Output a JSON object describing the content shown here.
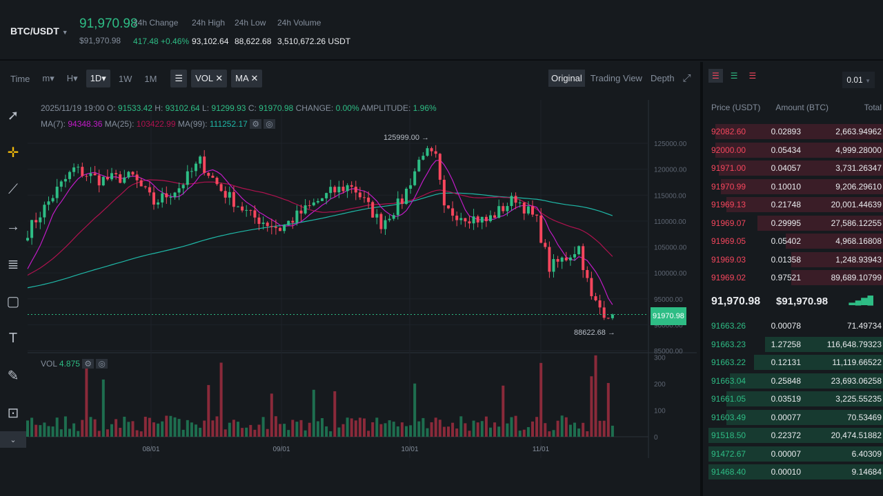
{
  "header": {
    "pair": "BTC/USDT",
    "last_price": "91,970.98",
    "last_price_usd": "$91,970.98",
    "stats": [
      {
        "label": "24h Change",
        "value": "417.48 +0.46%"
      },
      {
        "label": "24h High",
        "value": "93,102.64"
      },
      {
        "label": "24h Low",
        "value": "88,622.68"
      },
      {
        "label": "24h Volume",
        "value": "3,510,672.26 USDT"
      }
    ]
  },
  "toolbar": {
    "intervals": [
      "Time",
      "m▾",
      "H▾",
      "1D▾",
      "1W",
      "1M"
    ],
    "active": "1D▾",
    "indicators": [
      "VOL ✕",
      "MA ✕"
    ],
    "views": [
      "Original",
      "Trading View",
      "Depth"
    ]
  },
  "chart_info": {
    "date": "2025/11/19 19:00",
    "o_label": "O:",
    "o": "91533.42",
    "h_label": "H:",
    "h": "93102.64",
    "l_label": "L:",
    "l": "91299.93",
    "c_label": "C:",
    "c": "91970.98",
    "change_label": "CHANGE:",
    "change": "0.00%",
    "amp_label": "AMPLITUDE:",
    "amp": "1.96%",
    "ma7_label": "MA(7):",
    "ma7": "94348.36",
    "ma25_label": "MA(25):",
    "ma25": "103422.99",
    "ma99_label": "MA(99):",
    "ma99": "111252.17",
    "vol_label": "VOL",
    "vol": "4.875",
    "high_marker": "125999.00 →",
    "low_marker": "88622.68 →",
    "price_tag": "91970.98"
  },
  "chart_data": {
    "type": "candlestick",
    "y_ticks": [
      "125000.00",
      "120000.00",
      "115000.00",
      "110000.00",
      "105000.00",
      "100000.00",
      "95000.00",
      "90000.00",
      "85000.00"
    ],
    "vol_ticks": [
      "300",
      "200",
      "100",
      "0"
    ],
    "x_ticks": [
      "08/01",
      "09/01",
      "10/01",
      "11/01"
    ],
    "colors": {
      "up": "#2ebd85",
      "down": "#f6465d",
      "ma7": "#c21bc8",
      "ma25": "#b0124f",
      "ma99": "#1fb9a8"
    },
    "close_anchors": [
      [
        0,
        108000
      ],
      [
        7,
        116000
      ],
      [
        11,
        120000
      ],
      [
        17,
        118000
      ],
      [
        25,
        118500
      ],
      [
        30,
        113500
      ],
      [
        36,
        116500
      ],
      [
        41,
        121500
      ],
      [
        46,
        116000
      ],
      [
        53,
        111000
      ],
      [
        60,
        108500
      ],
      [
        64,
        111000
      ],
      [
        72,
        115500
      ],
      [
        77,
        117000
      ],
      [
        84,
        109500
      ],
      [
        89,
        114000
      ],
      [
        94,
        123500
      ],
      [
        97,
        122000
      ],
      [
        99,
        112000
      ],
      [
        104,
        111000
      ],
      [
        109,
        110000
      ],
      [
        116,
        114500
      ],
      [
        121,
        110000
      ],
      [
        124,
        101000
      ],
      [
        128,
        103000
      ],
      [
        131,
        105000
      ],
      [
        134,
        95000
      ],
      [
        137,
        92500
      ],
      [
        139,
        91970
      ]
    ]
  },
  "orderbook": {
    "step": "0.01",
    "headers": [
      "Price (USDT)",
      "Amount (BTC)",
      "Total"
    ],
    "asks": [
      [
        "92082.60",
        "0.02893",
        "2,663.94962",
        0.96
      ],
      [
        "92000.00",
        "0.05434",
        "4,999.28000",
        0.96
      ],
      [
        "91971.00",
        "0.04057",
        "3,731.26347",
        0.94
      ],
      [
        "91970.99",
        "0.10010",
        "9,206.29610",
        0.93
      ],
      [
        "91969.13",
        "0.21748",
        "20,001.44639",
        0.9
      ],
      [
        "91969.07",
        "0.29995",
        "27,586.12255",
        0.72
      ],
      [
        "91969.05",
        "0.05402",
        "4,968.16808",
        0.56
      ],
      [
        "91969.03",
        "0.01358",
        "1,248.93943",
        0.53
      ],
      [
        "91969.02",
        "0.97521",
        "89,689.10799",
        0.53
      ]
    ],
    "mid_price": "91,970.98",
    "mid_usd": "$91,970.98",
    "bids": [
      [
        "91663.26",
        "0.00078",
        "71.49734",
        0
      ],
      [
        "91663.23",
        "1.27258",
        "116,648.79323",
        0.68
      ],
      [
        "91663.22",
        "0.12131",
        "11,119.66522",
        0.74
      ],
      [
        "91663.04",
        "0.25848",
        "23,693.06258",
        0.88
      ],
      [
        "91661.05",
        "0.03519",
        "3,225.55235",
        0.9
      ],
      [
        "91603.49",
        "0.00077",
        "70.53469",
        0.9
      ],
      [
        "91518.50",
        "0.22372",
        "20,474.51882",
        1
      ],
      [
        "91472.67",
        "0.00007",
        "6.40309",
        1
      ],
      [
        "91468.40",
        "0.00010",
        "9.14684",
        1
      ]
    ]
  }
}
